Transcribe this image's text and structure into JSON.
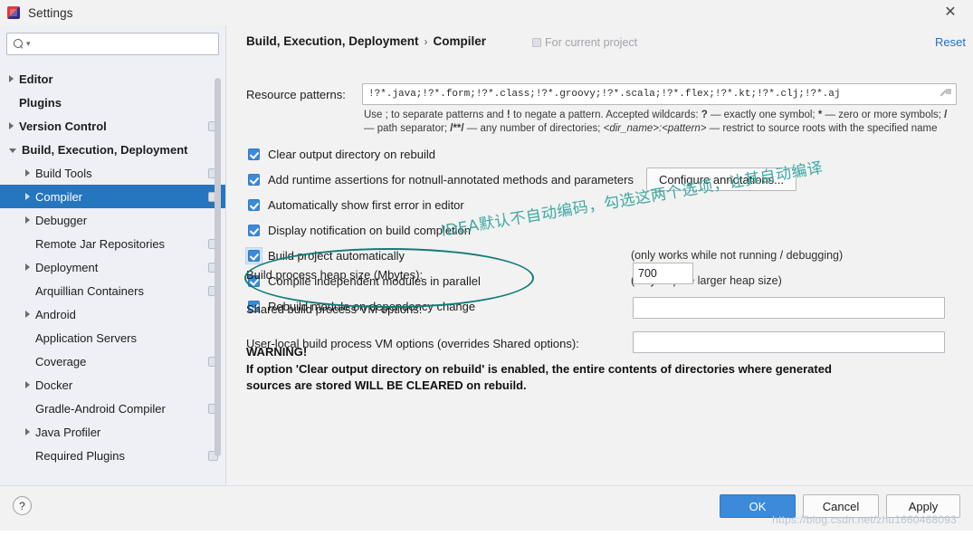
{
  "window": {
    "title": "Settings",
    "icon": "idea-app-icon",
    "close_label": "✕"
  },
  "sidebar": {
    "search": {
      "value": "",
      "placeholder": ""
    },
    "items": [
      {
        "label": "Editor",
        "indent": 0,
        "arrow": "collapsed",
        "bold": true,
        "badge": false,
        "selected": false
      },
      {
        "label": "Plugins",
        "indent": 0,
        "arrow": "none",
        "bold": true,
        "badge": false,
        "selected": false
      },
      {
        "label": "Version Control",
        "indent": 0,
        "arrow": "collapsed",
        "bold": true,
        "badge": true,
        "selected": false
      },
      {
        "label": "Build, Execution, Deployment",
        "indent": 0,
        "arrow": "expanded",
        "bold": true,
        "badge": false,
        "selected": false
      },
      {
        "label": "Build Tools",
        "indent": 1,
        "arrow": "collapsed",
        "bold": false,
        "badge": true,
        "selected": false
      },
      {
        "label": "Compiler",
        "indent": 1,
        "arrow": "collapsed",
        "bold": false,
        "badge": true,
        "selected": true
      },
      {
        "label": "Debugger",
        "indent": 1,
        "arrow": "collapsed",
        "bold": false,
        "badge": false,
        "selected": false
      },
      {
        "label": "Remote Jar Repositories",
        "indent": 1,
        "arrow": "none",
        "bold": false,
        "badge": true,
        "selected": false
      },
      {
        "label": "Deployment",
        "indent": 1,
        "arrow": "collapsed",
        "bold": false,
        "badge": true,
        "selected": false
      },
      {
        "label": "Arquillian Containers",
        "indent": 1,
        "arrow": "none",
        "bold": false,
        "badge": true,
        "selected": false
      },
      {
        "label": "Android",
        "indent": 1,
        "arrow": "collapsed",
        "bold": false,
        "badge": false,
        "selected": false
      },
      {
        "label": "Application Servers",
        "indent": 1,
        "arrow": "none",
        "bold": false,
        "badge": false,
        "selected": false
      },
      {
        "label": "Coverage",
        "indent": 1,
        "arrow": "none",
        "bold": false,
        "badge": true,
        "selected": false
      },
      {
        "label": "Docker",
        "indent": 1,
        "arrow": "collapsed",
        "bold": false,
        "badge": false,
        "selected": false
      },
      {
        "label": "Gradle-Android Compiler",
        "indent": 1,
        "arrow": "none",
        "bold": false,
        "badge": true,
        "selected": false
      },
      {
        "label": "Java Profiler",
        "indent": 1,
        "arrow": "collapsed",
        "bold": false,
        "badge": false,
        "selected": false
      },
      {
        "label": "Required Plugins",
        "indent": 1,
        "arrow": "none",
        "bold": false,
        "badge": true,
        "selected": false
      }
    ]
  },
  "header": {
    "breadcrumb_parent": "Build, Execution, Deployment",
    "breadcrumb_separator": "›",
    "breadcrumb_current": "Compiler",
    "scope_label": "For current project",
    "reset_label": "Reset"
  },
  "resource_patterns": {
    "label": "Resource patterns:",
    "value": "!?*.java;!?*.form;!?*.class;!?*.groovy;!?*.scala;!?*.flex;!?*.kt;!?*.clj;!?*.aj",
    "placeholder": "",
    "expand_icon": "expand-field-icon",
    "hint_line1_a": "Use ; to separate patterns and ",
    "hint_bang": "!",
    "hint_line1_b": " to negate a pattern. Accepted wildcards: ",
    "hint_q": "?",
    "hint_line1_c": " — exactly one symbol; ",
    "hint_star": "*",
    "hint_line1_d": " — zero or",
    "hint_line2_a": "more symbols; ",
    "hint_slash": "/",
    "hint_line2_b": " — path separator; ",
    "hint_globstar": "/**/",
    "hint_line2_c": " — any number of directories;  ",
    "hint_dirname": "<dir_name>:<pattern>",
    "hint_line2_d": " — restrict to",
    "hint_line3": "source roots with the specified name"
  },
  "checkboxes": [
    {
      "label": "Clear output directory on rebuild",
      "checked": true,
      "note": "",
      "focused": false,
      "button": null
    },
    {
      "label": "Add runtime assertions for notnull-annotated methods and parameters",
      "checked": true,
      "note": "",
      "focused": false,
      "button": "Configure annotations..."
    },
    {
      "label": "Automatically show first error in editor",
      "checked": true,
      "note": "",
      "focused": false,
      "button": null
    },
    {
      "label": "Display notification on build completion",
      "checked": true,
      "note": "",
      "focused": false,
      "button": null
    },
    {
      "label": "Build project automatically",
      "checked": true,
      "note": "(only works while not running / debugging)",
      "focused": true,
      "button": null
    },
    {
      "label": "Compile independent modules in parallel",
      "checked": true,
      "note": "(may require larger heap size)",
      "focused": false,
      "button": null
    },
    {
      "label": "Rebuild module on dependency change",
      "checked": true,
      "note": "",
      "focused": false,
      "button": null
    }
  ],
  "fields": [
    {
      "label": "Build process heap size (Mbytes):",
      "value": "700",
      "placeholder": ""
    },
    {
      "label": "Shared build process VM options:",
      "value": "",
      "placeholder": ""
    },
    {
      "label": "User-local build process VM options (overrides Shared options):",
      "value": "",
      "placeholder": ""
    }
  ],
  "warning": {
    "title": "WARNING!",
    "line1": "If option 'Clear output directory on rebuild' is enabled, the entire contents of directories where generated",
    "line2": "sources are stored WILL BE CLEARED on rebuild."
  },
  "annotation": {
    "text": "IDEA默认不自动编码，勾选这两个选项，让其自动编译",
    "color": "#3fa8a2"
  },
  "footer": {
    "help_label": "?",
    "ok_label": "OK",
    "cancel_label": "Cancel",
    "apply_label": "Apply",
    "watermark": "https://blog.csdn.net/zhu1660468093"
  },
  "colors": {
    "accent": "#3c8ad9",
    "selection": "#2675bf",
    "link": "#2470c4",
    "annotation": "#3fa8a2"
  }
}
